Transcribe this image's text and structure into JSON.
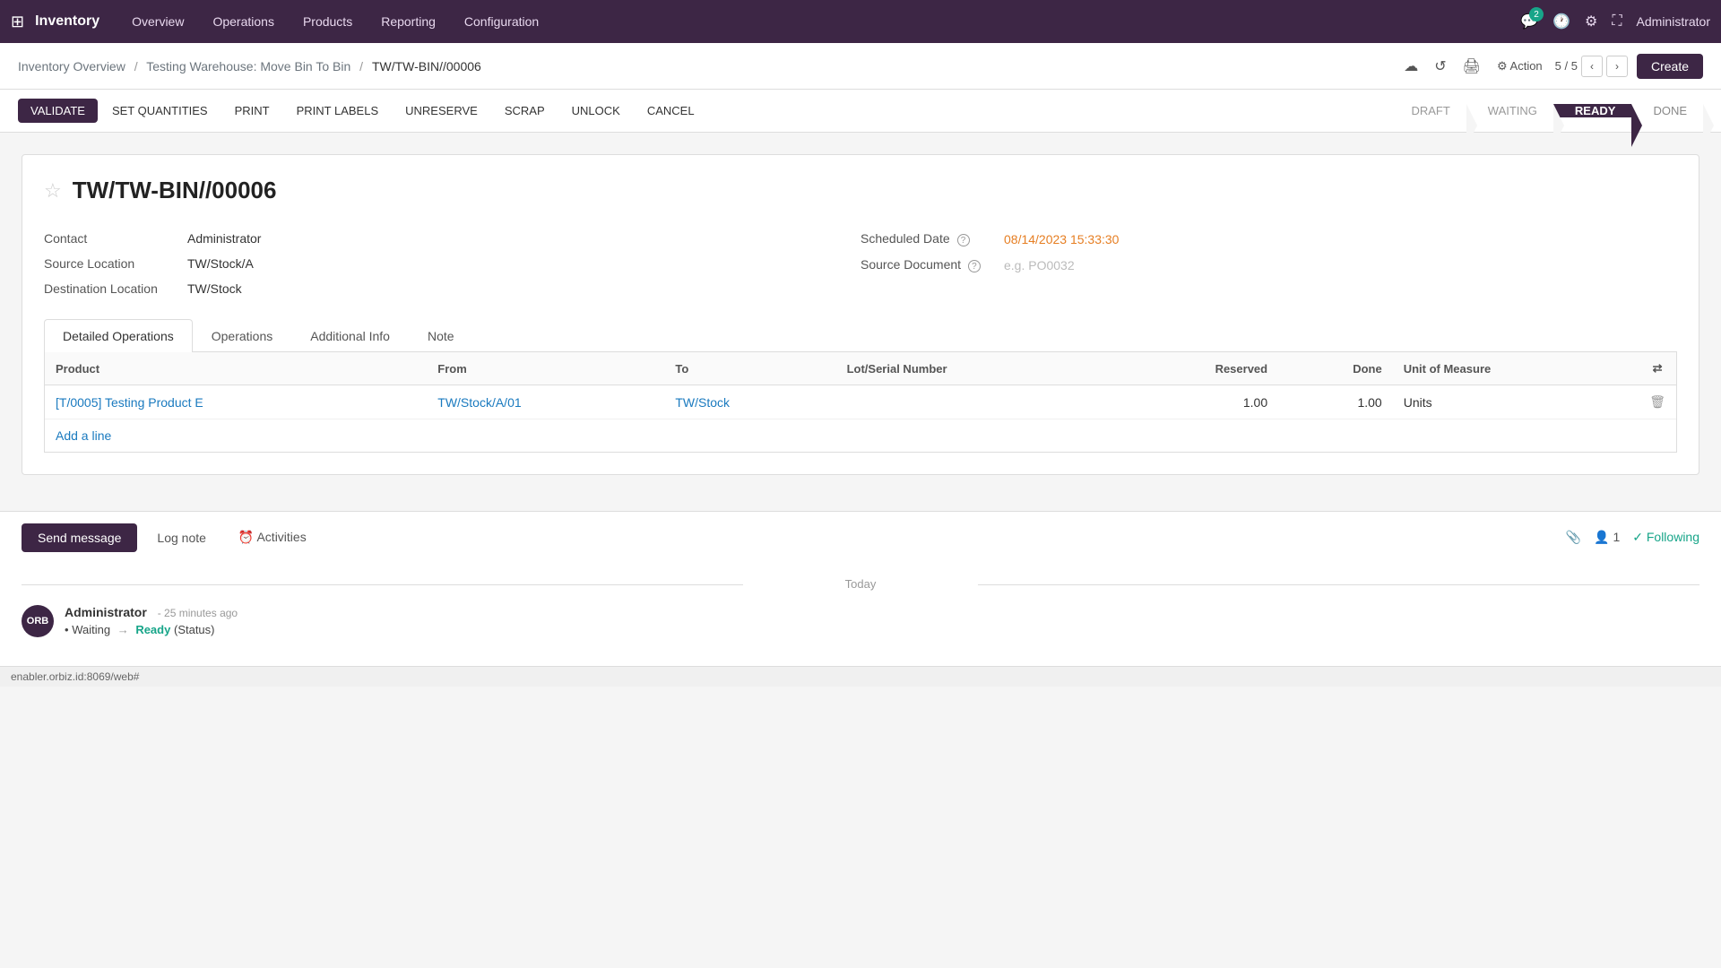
{
  "nav": {
    "app_name": "Inventory",
    "items": [
      "Overview",
      "Operations",
      "Products",
      "Reporting",
      "Configuration"
    ],
    "badge_count": "2",
    "admin": "Administrator"
  },
  "breadcrumb": {
    "parts": [
      "Inventory Overview",
      "Testing Warehouse: Move Bin To Bin",
      "TW/TW-BIN//00006"
    ],
    "separators": [
      "/",
      "/"
    ]
  },
  "pagination": {
    "current": "5",
    "total": "5",
    "display": "5 / 5"
  },
  "toolbar": {
    "validate": "VALIDATE",
    "set_quantities": "SET QUANTITIES",
    "print": "PRINT",
    "print_labels": "PRINT LABELS",
    "unreserve": "UNRESERVE",
    "scrap": "SCRAP",
    "unlock": "UNLOCK",
    "cancel": "CANCEL"
  },
  "status_steps": [
    "DRAFT",
    "WAITING",
    "READY",
    "DONE"
  ],
  "record": {
    "title": "TW/TW-BIN//00006",
    "contact_label": "Contact",
    "contact_value": "Administrator",
    "source_location_label": "Source Location",
    "source_location_value": "TW/Stock/A",
    "destination_location_label": "Destination Location",
    "destination_location_value": "TW/Stock",
    "scheduled_date_label": "Scheduled Date",
    "scheduled_date_value": "08/14/2023 15:33:30",
    "source_document_label": "Source Document",
    "source_document_placeholder": "e.g. PO0032"
  },
  "tabs": {
    "items": [
      "Detailed Operations",
      "Operations",
      "Additional Info",
      "Note"
    ],
    "active": "Detailed Operations"
  },
  "table": {
    "columns": [
      "Product",
      "From",
      "To",
      "Lot/Serial Number",
      "Reserved",
      "Done",
      "Unit of Measure"
    ],
    "rows": [
      {
        "product": "[T/0005] Testing Product E",
        "from": "TW/Stock/A/01",
        "to": "TW/Stock",
        "lot_serial": "",
        "reserved": "1.00",
        "done": "1.00",
        "unit": "Units"
      }
    ],
    "add_line": "Add a line"
  },
  "chatter": {
    "send_message": "Send message",
    "log_note": "Log note",
    "activities": "Activities",
    "follower_count": "1",
    "following": "Following",
    "attachment_icon": "📎",
    "today_label": "Today",
    "messages": [
      {
        "author": "Administrator",
        "time": "25 minutes ago",
        "status_from": "Waiting",
        "status_to": "Ready",
        "status_field": "Status",
        "avatar_text": "ORB"
      }
    ]
  },
  "footer": {
    "url": "enabler.orbiz.id:8069/web#"
  }
}
